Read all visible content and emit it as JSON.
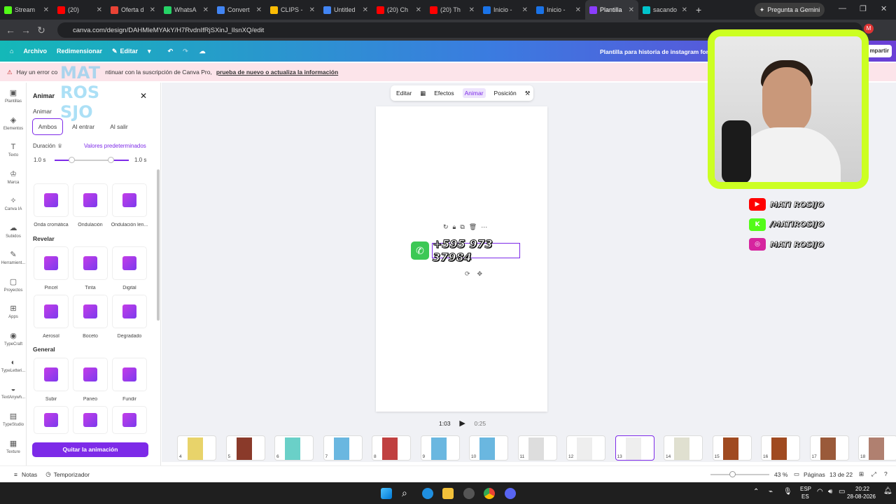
{
  "browser": {
    "tabs": [
      {
        "label": "Stream",
        "icon_color": "#53fc18"
      },
      {
        "label": "(20)",
        "icon_color": "#ff0000"
      },
      {
        "label": "Oferta d",
        "icon_color": "#ea4335"
      },
      {
        "label": "WhatsA",
        "icon_color": "#25d366"
      },
      {
        "label": "Convert",
        "icon_color": "#4285f4"
      },
      {
        "label": "CLIPS -",
        "icon_color": "#fbbc04"
      },
      {
        "label": "Untitled",
        "icon_color": "#4285f4"
      },
      {
        "label": "(20) Ch",
        "icon_color": "#ff0000"
      },
      {
        "label": "(20) Th",
        "icon_color": "#ff0000"
      },
      {
        "label": "Inicio -",
        "icon_color": "#1a73e8"
      },
      {
        "label": "Inicio -",
        "icon_color": "#1a73e8"
      },
      {
        "label": "Plantilla",
        "icon_color": "#8b3dff"
      },
      {
        "label": "sacando",
        "icon_color": "#00c4cc"
      }
    ],
    "new_tab": "+",
    "gemini": "Pregunta a Gemini",
    "url": "canva.com/design/DAHMleMYAkY/H7RvdnIfRjSXinJ_lIsnXQ/edit",
    "profile_initial": "M"
  },
  "canva_header": {
    "archivo": "Archivo",
    "redimensionar": "Redimensionar",
    "editar": "Editar",
    "template_name": "Plantilla para historia de instagram fondo",
    "share": "mpartir"
  },
  "warning": {
    "prefix": "Hay un error co",
    "middle": "ntinuar con la suscripción de Canva Pro,",
    "link": "prueba de nuevo o actualiza la información"
  },
  "rail": [
    {
      "label": "Plantillas",
      "icon": "templates-icon"
    },
    {
      "label": "Elementos",
      "icon": "elements-icon"
    },
    {
      "label": "Texto",
      "icon": "text-icon"
    },
    {
      "label": "Marca",
      "icon": "brand-icon"
    },
    {
      "label": "Canva IA",
      "icon": "canva-ai-icon"
    },
    {
      "label": "Subidos",
      "icon": "uploads-icon"
    },
    {
      "label": "Herramient...",
      "icon": "tools-icon"
    },
    {
      "label": "Proyectos",
      "icon": "projects-icon"
    },
    {
      "label": "Apps",
      "icon": "apps-icon"
    },
    {
      "label": "TypeCraft",
      "icon": "typecraft-icon"
    },
    {
      "label": "TypeLetteri...",
      "icon": "typelettering-icon"
    },
    {
      "label": "TextAnywh...",
      "icon": "textanywhere-icon"
    },
    {
      "label": "TypeStudio",
      "icon": "typestudio-icon"
    },
    {
      "label": "Texture",
      "icon": "texture-icon"
    }
  ],
  "panel": {
    "title": "Animar",
    "subtitle": "Animar",
    "modes": [
      "Ambos",
      "Al entrar",
      "Al salir"
    ],
    "duration_label": "Duración",
    "presets_link": "Valores predeterminados",
    "duration_in": "1.0 s",
    "duration_out": "1.0 s",
    "group1": [
      {
        "label": "Onda cromática"
      },
      {
        "label": "Ondulación"
      },
      {
        "label": "Ondulación len..."
      }
    ],
    "section_revelar": "Revelar",
    "group2": [
      {
        "label": "Pincel"
      },
      {
        "label": "Tinta"
      },
      {
        "label": "Digital"
      },
      {
        "label": "Aerosol"
      },
      {
        "label": "Boceto"
      },
      {
        "label": "Degradado"
      }
    ],
    "section_general": "General",
    "group3": [
      {
        "label": "Subir"
      },
      {
        "label": "Paneo"
      },
      {
        "label": "Fundir"
      }
    ],
    "remove_button": "Quitar la animación"
  },
  "context_toolbar": {
    "editar": "Editar",
    "efectos": "Efectos",
    "animar": "Animar",
    "posicion": "Posición"
  },
  "canvas": {
    "phone_text": "+595 973 37984"
  },
  "playback": {
    "current": "1:03",
    "total": "0:25"
  },
  "pages_strip": [
    {
      "num": "4",
      "color": "#e8d36a"
    },
    {
      "num": "5",
      "color": "#8a3a2a"
    },
    {
      "num": "6",
      "color": "#6ad0c8"
    },
    {
      "num": "7",
      "color": "#6ab7e0"
    },
    {
      "num": "8",
      "color": "#c04040"
    },
    {
      "num": "9",
      "color": "#6ab7e0"
    },
    {
      "num": "10",
      "color": "#6ab7e0"
    },
    {
      "num": "11",
      "color": "#dddddd"
    },
    {
      "num": "12",
      "color": "#eeeeee"
    },
    {
      "num": "13",
      "color": "#eeeeee"
    },
    {
      "num": "14",
      "color": "#e0e0d0"
    },
    {
      "num": "15",
      "color": "#a04a20"
    },
    {
      "num": "16",
      "color": "#a04a20"
    },
    {
      "num": "17",
      "color": "#9a5a3a"
    },
    {
      "num": "18",
      "color": "#b08070"
    }
  ],
  "footer": {
    "notas": "Notas",
    "temporizador": "Temporizador",
    "zoom": "43 %",
    "paginas": "Páginas",
    "page_count": "13 de 22"
  },
  "taskbar": {
    "lang1": "ESP",
    "lang2": "ES",
    "time": "20:22",
    "date": "28-08-2026"
  },
  "overlay": {
    "logo_text": [
      "MAT",
      "ROS",
      "SJO"
    ],
    "socials": [
      {
        "handle": "MATI ROSIJO",
        "icon": "youtube-icon",
        "color": "#ff0000"
      },
      {
        "handle": "/MATIROSIJO",
        "icon": "kick-icon",
        "color": "#53fc18"
      },
      {
        "handle": "MATI ROSIJO",
        "icon": "instagram-icon",
        "color": "#d6249f"
      }
    ]
  }
}
